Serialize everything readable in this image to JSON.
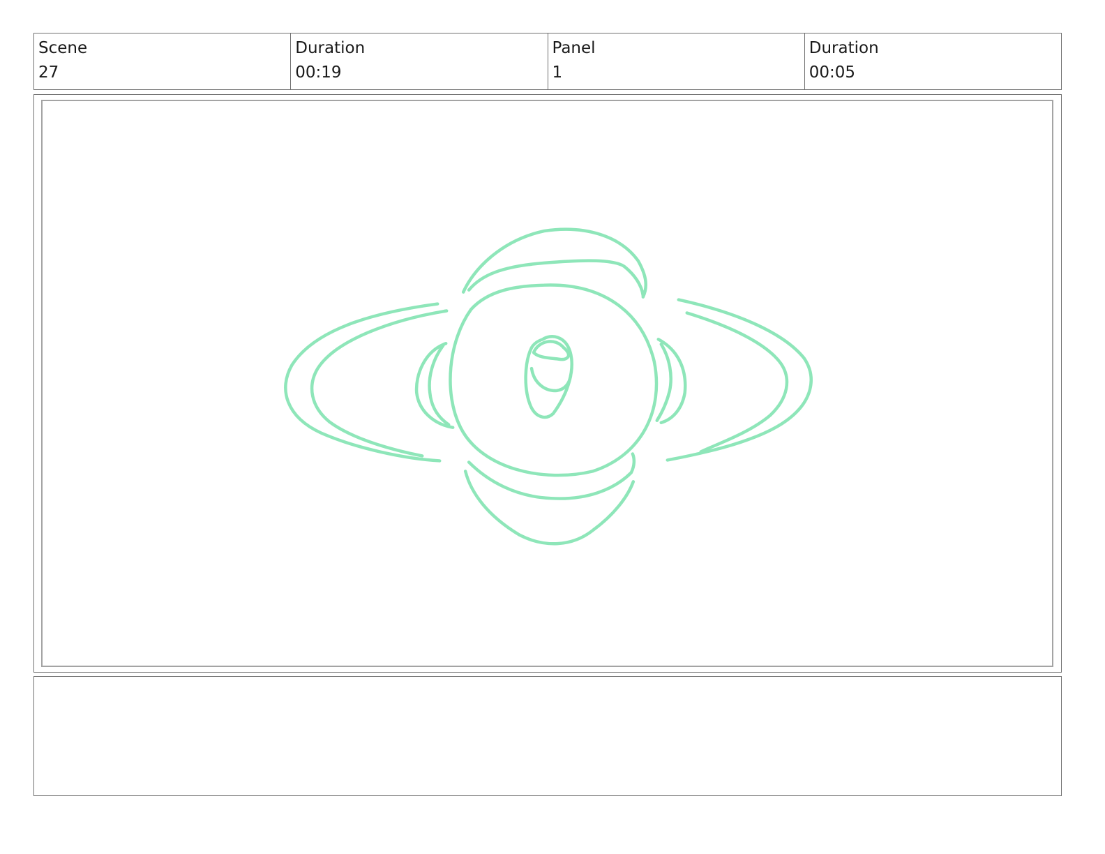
{
  "header": {
    "cells": [
      {
        "label": "Scene",
        "value": "27"
      },
      {
        "label": "Duration",
        "value": "00:19"
      },
      {
        "label": "Panel",
        "value": "1"
      },
      {
        "label": "Duration",
        "value": "00:05"
      }
    ]
  },
  "panel": {
    "sketch_color": "#8ee6b9",
    "sketch_subject": "stylized-eye-with-petal-rings"
  },
  "notes": {
    "text": ""
  }
}
